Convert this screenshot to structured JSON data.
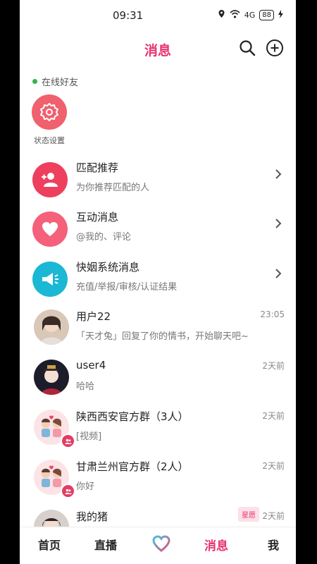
{
  "status_bar": {
    "time": "09:31",
    "signal": "4G",
    "battery": "88"
  },
  "header": {
    "title": "消息"
  },
  "online": {
    "label": "在线好友",
    "status_setting_label": "状态设置"
  },
  "system_items": [
    {
      "title": "匹配推荐",
      "subtitle": "为你推荐匹配的人",
      "icon": "add-user-icon",
      "color": "#ee3f5f"
    },
    {
      "title": "互动消息",
      "subtitle": "@我的、评论",
      "icon": "heart-icon",
      "color": "#f5607a"
    },
    {
      "title": "快姻系统消息",
      "subtitle": "充值/举报/审核/认证结果",
      "icon": "megaphone-icon",
      "color": "#1ab8d4"
    }
  ],
  "conversations": [
    {
      "name": "用户22",
      "preview": "「天才兔」回复了你的情书，开始聊天吧~",
      "time": "23:05"
    },
    {
      "name": "user4",
      "preview": "哈哈",
      "time": "2天前"
    },
    {
      "name": "陕西西安官方群（3人）",
      "preview": "[视频]",
      "time": "2天前"
    },
    {
      "name": "甘肃兰州官方群（2人）",
      "preview": "你好",
      "time": "2天前"
    },
    {
      "name": "我的猪",
      "preview": "",
      "time": "2天前",
      "tag": "星愿"
    }
  ],
  "bottom_nav": {
    "home": "首页",
    "live": "直播",
    "messages": "消息",
    "me": "我"
  },
  "colors": {
    "accent": "#e8336d"
  }
}
